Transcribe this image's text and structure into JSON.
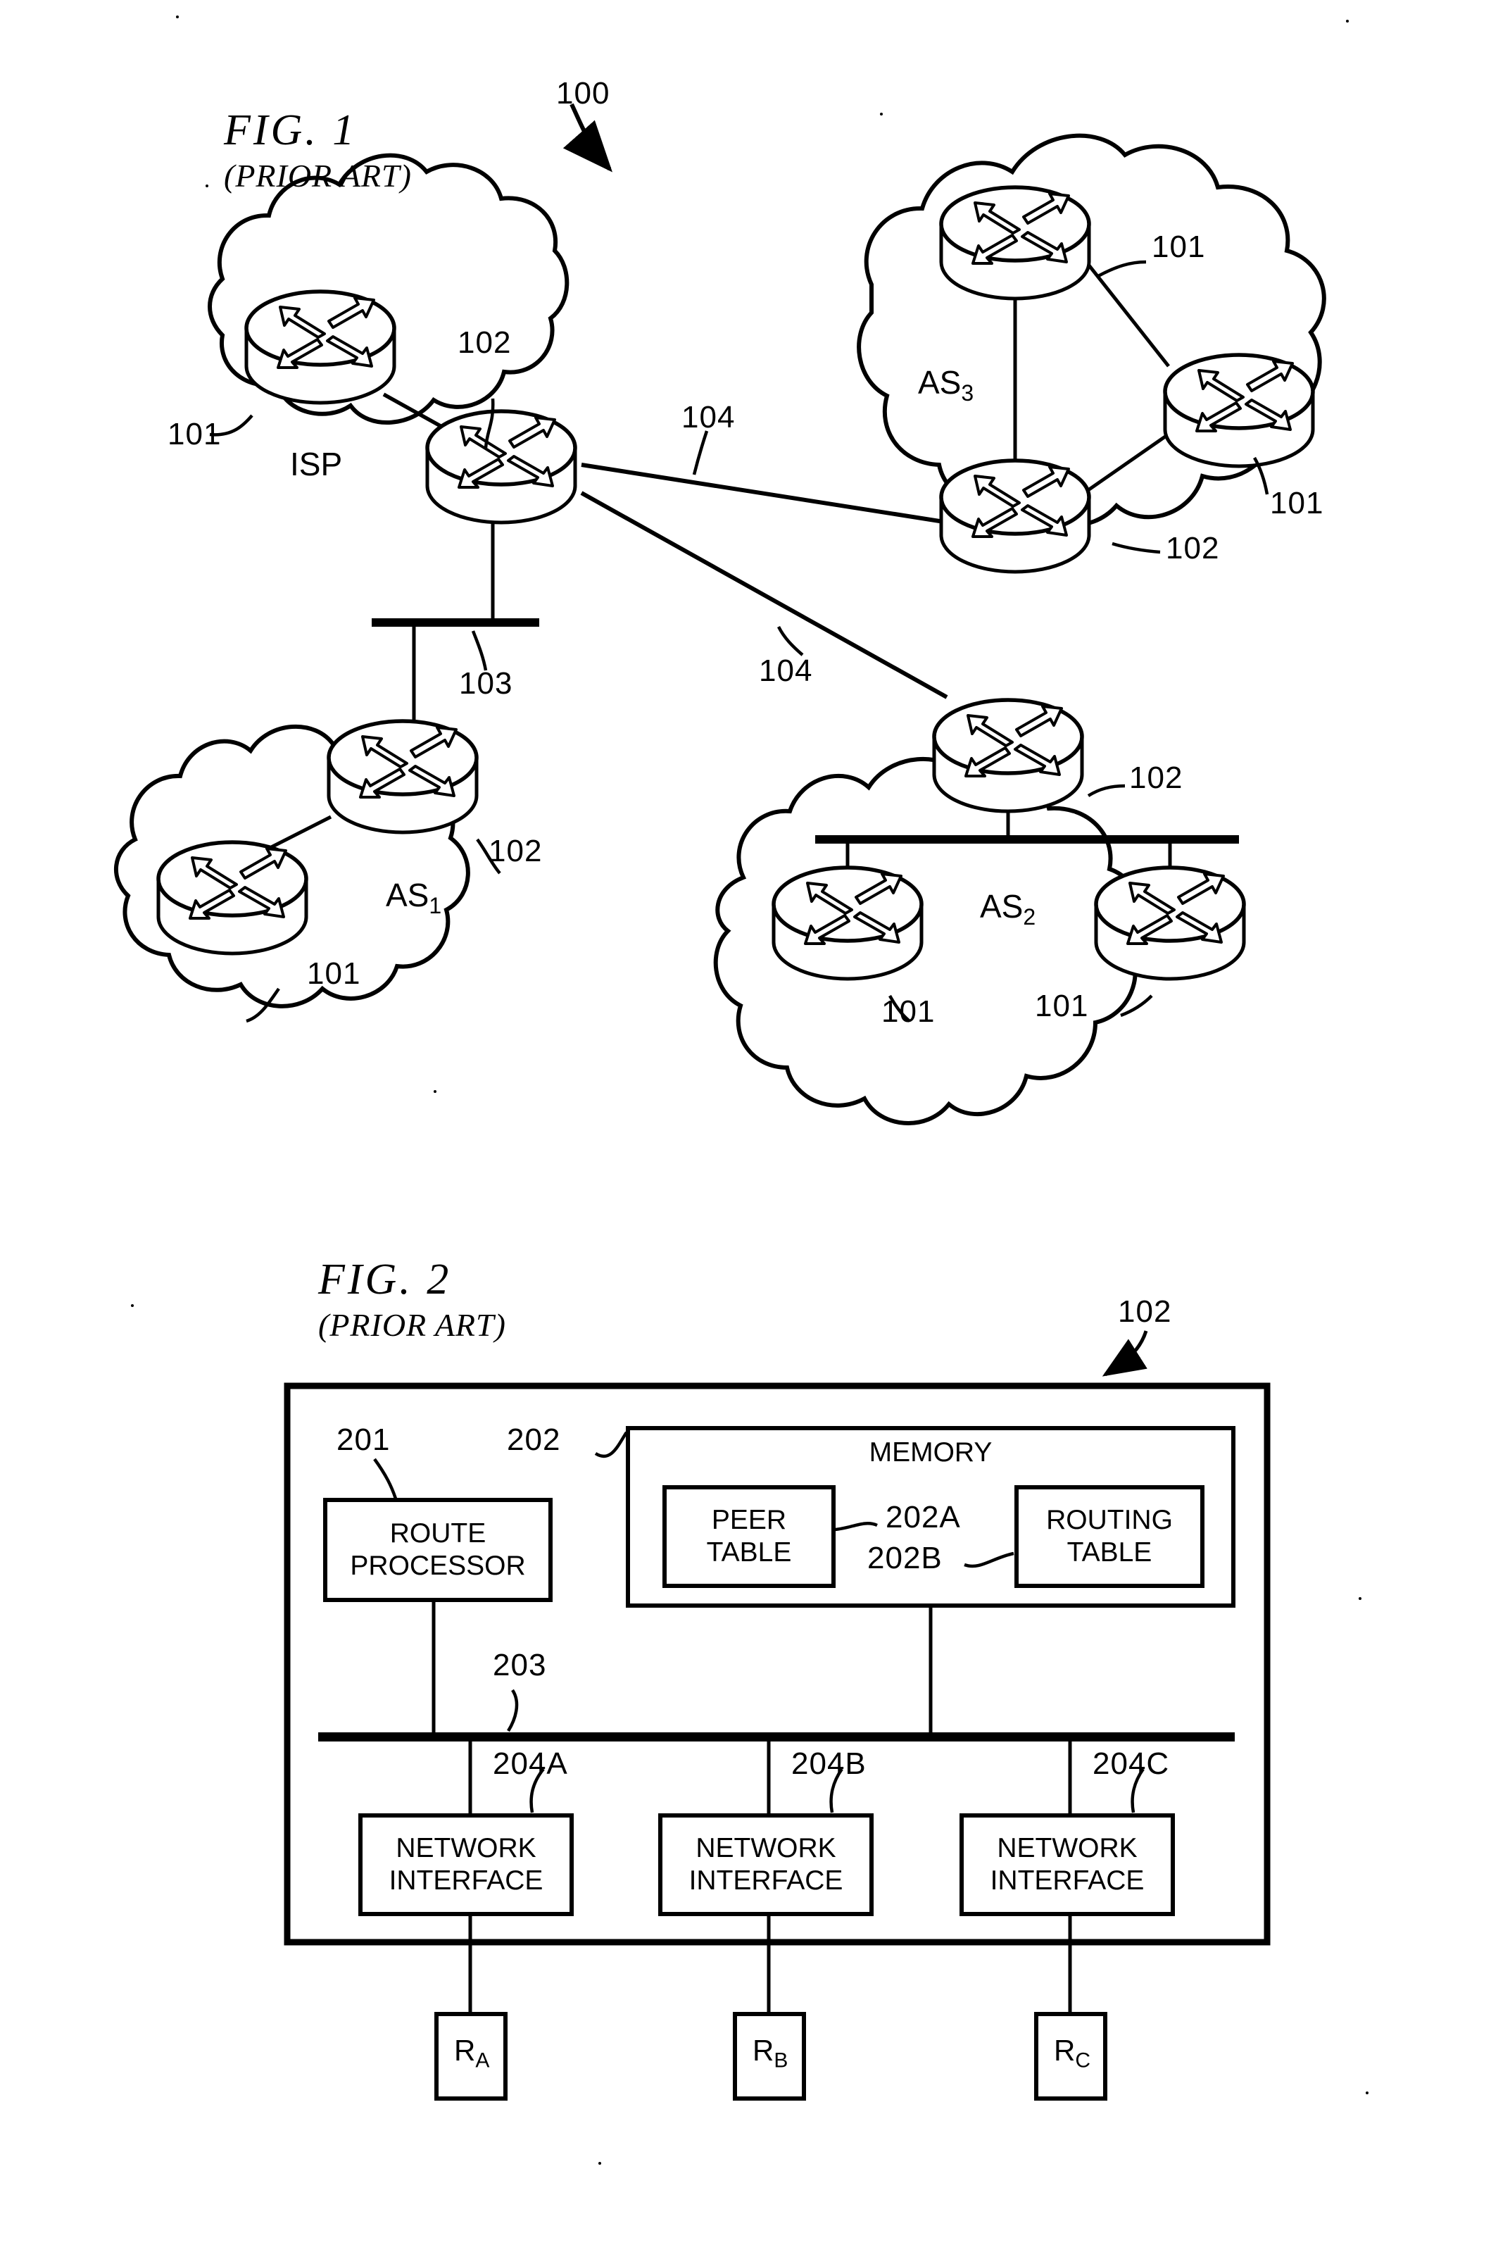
{
  "figures": [
    {
      "id": "fig1",
      "title_line1": "FIG. 1",
      "title_line2": "(PRIOR ART)",
      "system_ref": "100",
      "clouds": [
        {
          "name": "isp",
          "caption": "ISP",
          "caption_sub": ""
        },
        {
          "name": "as3",
          "caption": "AS",
          "caption_sub": "3"
        },
        {
          "name": "as1",
          "caption": "AS",
          "caption_sub": "1"
        },
        {
          "name": "as2",
          "caption": "AS",
          "caption_sub": "2"
        }
      ],
      "refs": {
        "isp_router_internal": "101",
        "isp_router_border": "102",
        "as3_router_top": "101",
        "as3_router_right": "101",
        "as3_router_border": "102",
        "as1_router_internal": "101",
        "as1_router_border": "102",
        "as2_router_border": "102",
        "as2_router_left": "101",
        "as2_router_right": "101",
        "shared_medium": "103",
        "peer_link_upper": "104",
        "peer_link_lower": "104"
      }
    },
    {
      "id": "fig2",
      "title_line1": "FIG. 2",
      "title_line2": "(PRIOR ART)",
      "device_ref": "102",
      "blocks": [
        {
          "name": "route-processor",
          "label": "ROUTE\nPROCESSOR",
          "ref": "201"
        },
        {
          "name": "memory",
          "label": "MEMORY",
          "ref": "202"
        },
        {
          "name": "peer-table",
          "label": "PEER\nTABLE",
          "ref": "202A"
        },
        {
          "name": "routing-table",
          "label": "ROUTING\nTABLE",
          "ref": "202B"
        },
        {
          "name": "bus",
          "label": "",
          "ref": "203"
        },
        {
          "name": "network-interface-a",
          "label": "NETWORK\nINTERFACE",
          "ref": "204A"
        },
        {
          "name": "network-interface-b",
          "label": "NETWORK\nINTERFACE",
          "ref": "204B"
        },
        {
          "name": "network-interface-c",
          "label": "NETWORK\nINTERFACE",
          "ref": "204C"
        }
      ],
      "peers": [
        {
          "name": "peer-a",
          "label": "R",
          "sub": "A"
        },
        {
          "name": "peer-b",
          "label": "R",
          "sub": "B"
        },
        {
          "name": "peer-c",
          "label": "R",
          "sub": "C"
        }
      ]
    }
  ],
  "colors": {
    "ink": "#000000",
    "paper": "#ffffff"
  }
}
